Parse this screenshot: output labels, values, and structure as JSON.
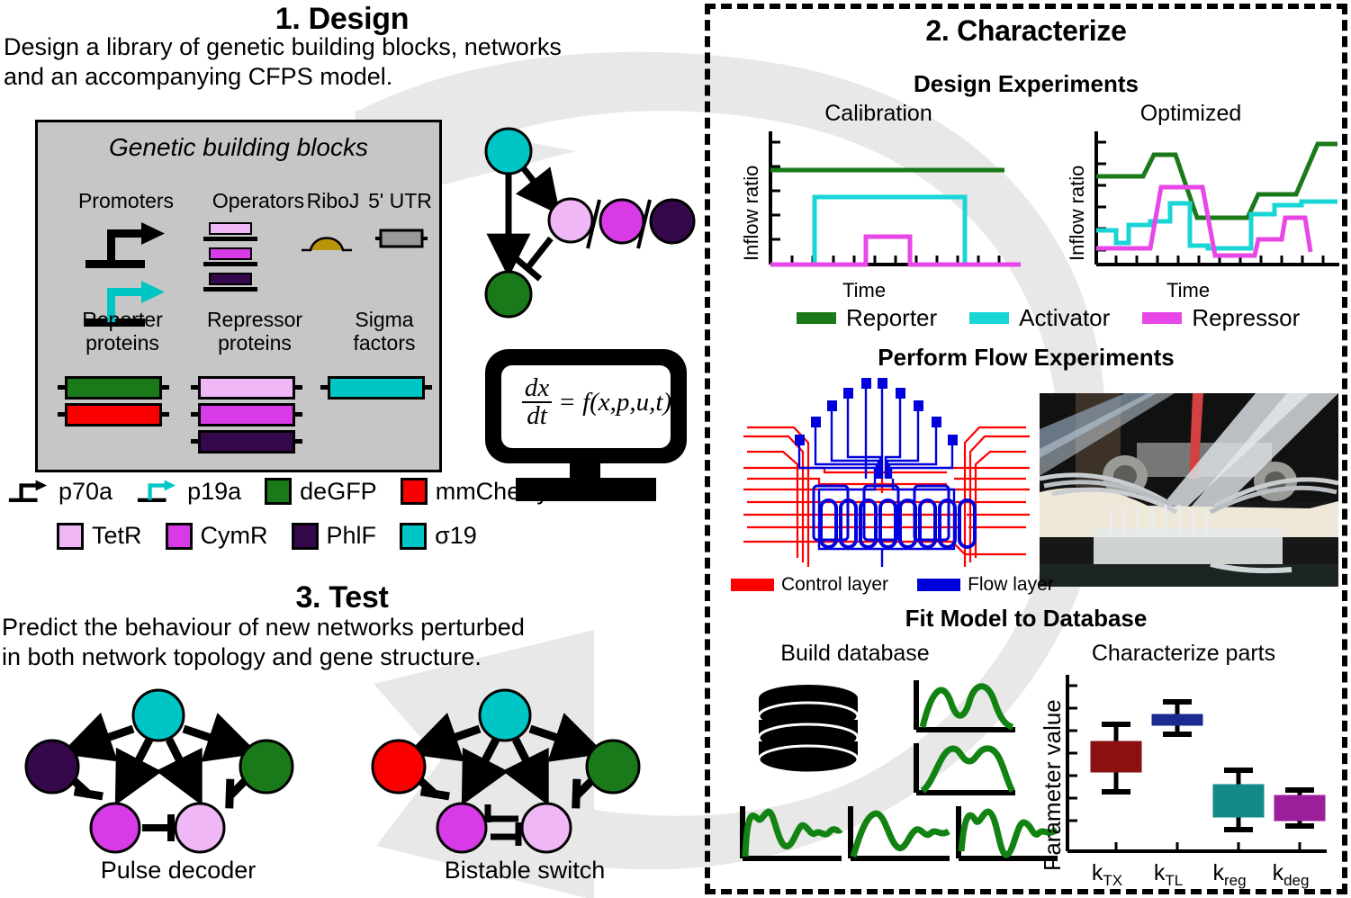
{
  "figure": {
    "kind": "design-build-test cycle schematic",
    "background_cycle_color": "#e8e8e8"
  },
  "section1": {
    "title": "1. Design",
    "body": "Design a library of genetic building blocks, networks and an accompanying CFPS model.",
    "body_line1": "Design a library of genetic building blocks, networks",
    "body_line2": "and an accompanying CFPS model.",
    "box_title": "Genetic building blocks",
    "column_labels_top": [
      "Promoters",
      "Operators",
      "RiboJ",
      "5' UTR"
    ],
    "column_labels_bottom": [
      "Reporter proteins",
      "Repressor proteins",
      "Sigma factors"
    ],
    "reporter_label_l1": "Reporter",
    "reporter_label_l2": "proteins",
    "repressor_label_l1": "Repressor",
    "repressor_label_l2": "proteins",
    "sigma_label_l1": "Sigma",
    "sigma_label_l2": "factors",
    "model_equation_numerator": "dx",
    "model_equation_denominator": "dt",
    "model_equation_rhs": "= f(x,p,u,t)"
  },
  "key": {
    "row1": [
      {
        "label": "p70a",
        "color": "#000000",
        "icon": "promoter-arrow-black"
      },
      {
        "label": "p19a",
        "color": "#00c5c5",
        "icon": "promoter-arrow-cyan"
      },
      {
        "label": "deGFP",
        "color": "#1a7a1a",
        "icon": "color-swatch"
      },
      {
        "label": "mmCherry",
        "color": "#fb0000",
        "icon": "color-swatch"
      }
    ],
    "row2": [
      {
        "label": "TetR",
        "color": "#efb7f5",
        "icon": "color-swatch"
      },
      {
        "label": "CymR",
        "color": "#d93ae8",
        "icon": "color-swatch"
      },
      {
        "label": "PhlF",
        "color": "#34084a",
        "icon": "color-swatch"
      },
      {
        "label": "σ19",
        "color": "#00c5c5",
        "icon": "color-swatch"
      }
    ]
  },
  "section2": {
    "title": "2. Characterize",
    "sub1": "Design Experiments",
    "sub2": "Perform Flow Experiments",
    "sub3": "Fit Model to Database",
    "chip_legend": [
      {
        "label": "Control layer",
        "color": "#ff0000"
      },
      {
        "label": "Flow layer",
        "color": "#0000dd"
      }
    ],
    "db_caption": "Build database",
    "parts_caption": "Characterize parts"
  },
  "section3": {
    "title": "3. Test",
    "body_line1": "Predict the behaviour of new networks perturbed",
    "body_line2": "in both network topology and gene structure.",
    "network_a_caption": "Pulse decoder",
    "network_b_caption": "Bistable switch"
  },
  "chart_data": [
    {
      "type": "line",
      "name": "calibration-inflow-chart",
      "title": "Calibration",
      "xlabel": "Time",
      "ylabel": "Inflow ratio",
      "xlim": [
        0,
        100
      ],
      "ylim": [
        0,
        10
      ],
      "grid": false,
      "legend": [
        "Reporter",
        "Activator",
        "Repressor"
      ],
      "legend_position": "below",
      "series": [
        {
          "name": "Reporter",
          "color": "#1a7a1a",
          "x": [
            0,
            100
          ],
          "values": [
            7.1,
            7.1
          ]
        },
        {
          "name": "Activator",
          "color": "#19d5d5",
          "x": [
            0,
            17,
            17,
            80,
            80,
            100
          ],
          "values": [
            0,
            0,
            5.0,
            5.0,
            0,
            0
          ]
        },
        {
          "name": "Repressor",
          "color": "#e847e8",
          "x": [
            0,
            38,
            38,
            60,
            60,
            100
          ],
          "values": [
            0,
            0,
            2.1,
            2.1,
            0,
            0
          ]
        }
      ]
    },
    {
      "type": "line",
      "name": "optimized-inflow-chart",
      "title": "Optimized",
      "xlabel": "Time",
      "ylabel": "Inflow ratio",
      "xlim": [
        0,
        100
      ],
      "ylim": [
        0,
        10
      ],
      "grid": false,
      "legend": [
        "Reporter",
        "Activator",
        "Repressor"
      ],
      "legend_position": "below",
      "series": [
        {
          "name": "Reporter",
          "color": "#1a7a1a",
          "x": [
            0,
            20,
            20,
            26,
            26,
            32,
            32,
            38,
            38,
            66,
            66,
            79,
            79,
            87,
            87,
            100
          ],
          "values": [
            6.6,
            6.6,
            8.2,
            8.2,
            8.2,
            8.2,
            6.6,
            4.6,
            4.6,
            4.6,
            6.1,
            6.1,
            6.1,
            9.0,
            9.0,
            9.0
          ]
        },
        {
          "name": "Activator",
          "color": "#19d5d5",
          "x": [
            0,
            8,
            8,
            13,
            13,
            20,
            20,
            30,
            30,
            38,
            38,
            45,
            45,
            63,
            63,
            72,
            72,
            85,
            85,
            100
          ],
          "values": [
            2.6,
            2.6,
            1.7,
            1.7,
            3.0,
            3.0,
            3.2,
            3.2,
            4.5,
            4.5,
            1.6,
            1.6,
            1.4,
            1.4,
            3.3,
            3.3,
            4.0,
            4.0,
            4.6,
            4.6
          ]
        },
        {
          "name": "Repressor",
          "color": "#e847e8",
          "x": [
            0,
            13,
            13,
            20,
            20,
            27,
            27,
            42,
            42,
            50,
            50,
            70,
            70,
            78,
            78,
            88,
            88,
            96,
            96,
            100
          ],
          "values": [
            1.4,
            1.4,
            1.4,
            1.4,
            3.2,
            6.0,
            6.0,
            6.0,
            1.4,
            0.9,
            0.9,
            0.9,
            2.0,
            2.0,
            2.0,
            4.2,
            4.2,
            4.2,
            1.0,
            1.0
          ]
        }
      ]
    },
    {
      "type": "box",
      "name": "parameter-value-boxplot",
      "title": "Characterize parts",
      "xlabel": "",
      "ylabel": "Parameter value",
      "ylim": [
        0,
        10
      ],
      "grid": false,
      "categories": [
        "k_TX",
        "k_TL",
        "k_reg",
        "k_deg"
      ],
      "category_labels": [
        {
          "base": "k",
          "sub": "TX"
        },
        {
          "base": "k",
          "sub": "TL"
        },
        {
          "base": "k",
          "sub": "reg"
        },
        {
          "base": "k",
          "sub": "deg"
        }
      ],
      "boxes": [
        {
          "category": "k_TX",
          "color": "#8b1010",
          "whisker_low": 3.55,
          "q1": 4.52,
          "median": 5.3,
          "q3": 6.18,
          "whisker_high": 6.95
        },
        {
          "category": "k_TL",
          "color": "#1a2a8e",
          "whisker_low": 6.55,
          "q1": 7.12,
          "median": 7.4,
          "q3": 7.62,
          "whisker_high": 8.1
        },
        {
          "category": "k_reg",
          "color": "#128a8a",
          "whisker_low": 1.5,
          "q1": 2.0,
          "median": 2.6,
          "q3": 3.55,
          "whisker_high": 4.1
        },
        {
          "category": "k_deg",
          "color": "#9b1f9b",
          "whisker_low": 1.85,
          "q1": 2.05,
          "median": 2.7,
          "q3": 3.1,
          "whisker_high": 3.2
        }
      ]
    }
  ]
}
